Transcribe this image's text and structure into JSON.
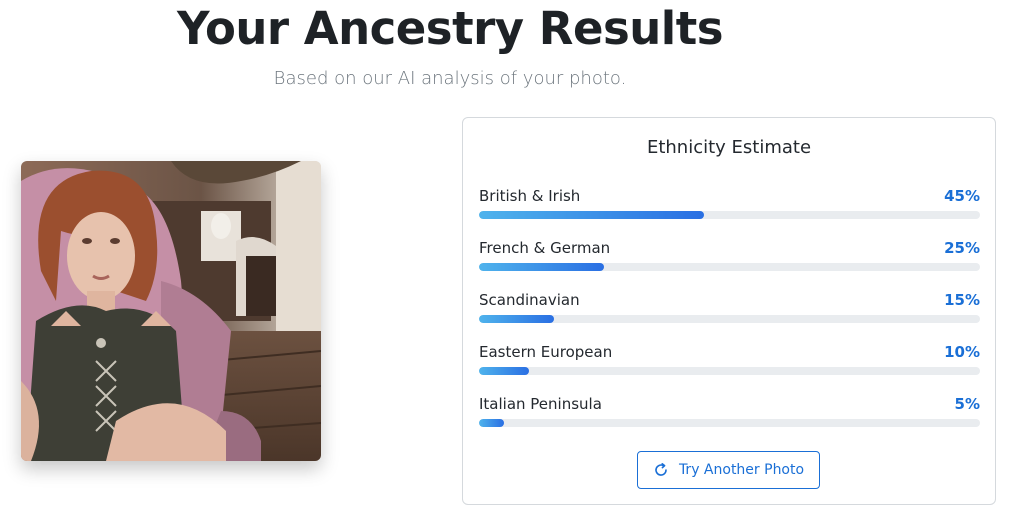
{
  "header": {
    "title": "Your Ancestry Results",
    "subtitle": "Based on our AI analysis of your photo."
  },
  "photo": {
    "alt": "Uploaded user photo"
  },
  "estimate": {
    "title": "Ethnicity Estimate",
    "rows": [
      {
        "label": "British & Irish",
        "percent_text": "45%",
        "value": 45
      },
      {
        "label": "French & German",
        "percent_text": "25%",
        "value": 25
      },
      {
        "label": "Scandinavian",
        "percent_text": "15%",
        "value": 15
      },
      {
        "label": "Eastern European",
        "percent_text": "10%",
        "value": 10
      },
      {
        "label": "Italian Peninsula",
        "percent_text": "5%",
        "value": 5
      }
    ]
  },
  "actions": {
    "retry_label": "Try Another Photo",
    "retry_icon": "refresh-icon"
  },
  "colors": {
    "accent": "#1a6fd6",
    "bar_start": "#4fb3ec",
    "bar_end": "#2a6fe3",
    "track": "#e9ecef"
  }
}
